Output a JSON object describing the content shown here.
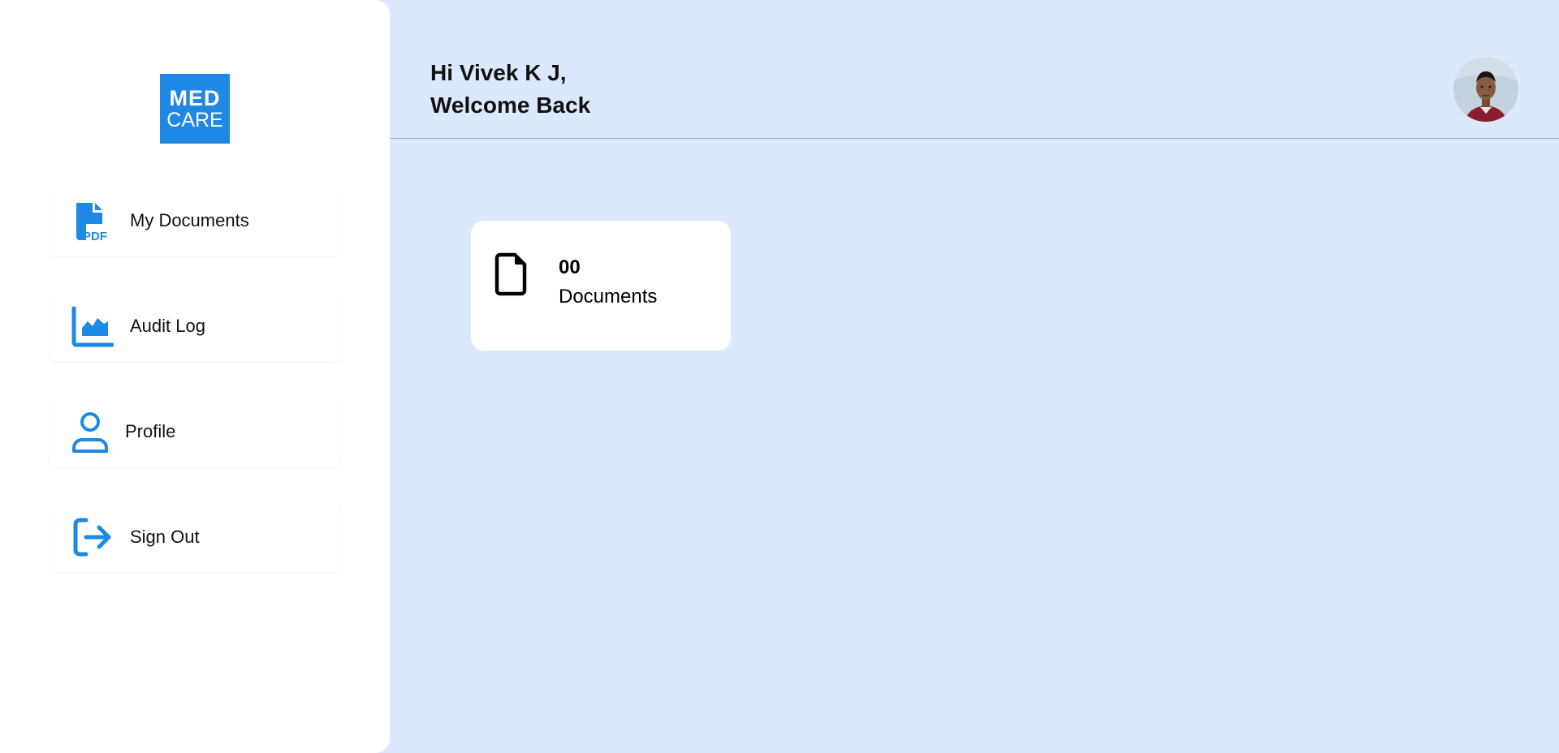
{
  "logo": {
    "line1": "MED",
    "line2": "CARE"
  },
  "sidebar": {
    "items": [
      {
        "label": "My Documents",
        "icon": "pdf-file-icon"
      },
      {
        "label": "Audit Log",
        "icon": "area-chart-icon"
      },
      {
        "label": "Profile",
        "icon": "user-icon"
      },
      {
        "label": "Sign Out",
        "icon": "sign-out-icon"
      }
    ]
  },
  "header": {
    "greeting_line1": "Hi Vivek K J,",
    "greeting_line2": "Welcome Back",
    "avatar": "user-avatar-photo"
  },
  "stats": {
    "documents_count": "00",
    "documents_label": "Documents",
    "icon": "document-icon"
  },
  "colors": {
    "accent": "#1e88e5",
    "background": "#dce9fd",
    "sidebar": "#ffffff",
    "divider": "#7fb3ea"
  }
}
